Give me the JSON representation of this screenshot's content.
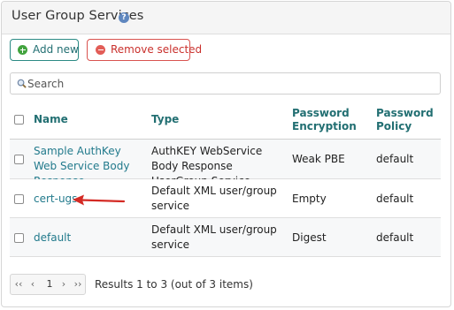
{
  "header": {
    "title": "User Group Services",
    "help_icon": "help-icon"
  },
  "toolbar": {
    "add_label": "Add new",
    "remove_label": "Remove selected"
  },
  "search": {
    "placeholder": "Search",
    "value": ""
  },
  "table": {
    "columns": [
      "Name",
      "Type",
      "Password\nEncryption",
      "Password\nPolicy"
    ],
    "rows": [
      {
        "name": "Sample AuthKey Web Service Body Response",
        "type": "AuthKEY WebService Body Response UserGroup Service",
        "encryption": "Weak PBE",
        "policy": "default"
      },
      {
        "name": "cert-ugs",
        "type": "Default XML user/group service",
        "encryption": "Empty",
        "policy": "default"
      },
      {
        "name": "default",
        "type": "Default XML user/group service",
        "encryption": "Digest",
        "policy": "default"
      }
    ]
  },
  "pager": {
    "first": "‹‹",
    "prev": "‹",
    "page": "1",
    "next": "›",
    "last": "››",
    "info": "Results 1 to 3 (out of 3 items)"
  },
  "colors": {
    "accent": "#226f72",
    "link": "#227a8c",
    "danger": "#d9534f",
    "add": "#42a33e",
    "annotation_arrow": "#d42a24"
  }
}
